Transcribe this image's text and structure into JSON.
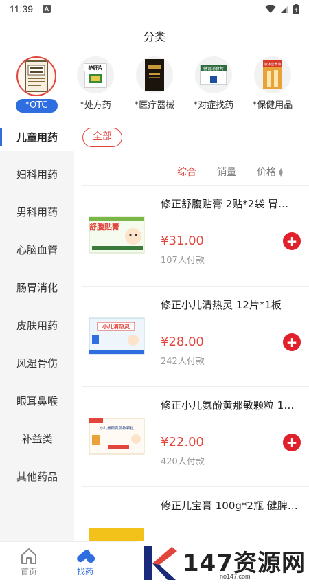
{
  "status": {
    "time": "11:39",
    "a_icon": "A"
  },
  "header": {
    "title": "分类"
  },
  "categories": [
    {
      "label": "*OTC",
      "active": true,
      "icon": "otc-book-icon"
    },
    {
      "label": "*处方药",
      "active": false,
      "icon": "prescription-box-icon",
      "box_text": "护肝片"
    },
    {
      "label": "*医疗器械",
      "active": false,
      "icon": "medical-device-box-icon"
    },
    {
      "label": "*对症找药",
      "active": false,
      "icon": "symptom-medicine-box-icon",
      "box_text": "健胃消食片"
    },
    {
      "label": "*保健用品",
      "active": false,
      "icon": "health-product-box-icon",
      "box_text": "液体营养液"
    }
  ],
  "sidebar": {
    "items": [
      {
        "label": "儿童用药",
        "active": true
      },
      {
        "label": "妇科用药"
      },
      {
        "label": "男科用药"
      },
      {
        "label": "心脑血管"
      },
      {
        "label": "肠胃消化"
      },
      {
        "label": "皮肤用药"
      },
      {
        "label": "风湿骨伤"
      },
      {
        "label": "眼耳鼻喉"
      },
      {
        "label": "补益类"
      },
      {
        "label": "其他药品"
      }
    ]
  },
  "filter": {
    "all_label": "全部"
  },
  "sort": {
    "comprehensive": "综合",
    "sales": "销量",
    "price": "价格"
  },
  "products": [
    {
      "title": "修正舒腹贴膏 2贴*2袋 胃…",
      "price": "¥31.00",
      "paid": "107人付款",
      "box_text": "舒腹贴膏"
    },
    {
      "title": "修正小儿清热灵 12片*1板",
      "price": "¥28.00",
      "paid": "242人付款",
      "box_text": "小儿清热灵"
    },
    {
      "title": "修正小儿氨酚黄那敏颗粒 1…",
      "price": "¥22.00",
      "paid": "420人付款",
      "box_text": "小儿氨酚黄那敏颗粒"
    },
    {
      "title": "修正儿宝膏 100g*2瓶 健脾…",
      "price": "",
      "paid": "",
      "box_text": ""
    }
  ],
  "bottom_nav": [
    {
      "label": "首页",
      "icon": "home-icon",
      "active": false
    },
    {
      "label": "找药",
      "icon": "pills-icon",
      "active": true
    }
  ],
  "watermark": {
    "text": "147资源网",
    "url": "no147.com"
  },
  "colors": {
    "accent_red": "#e2453c",
    "accent_blue": "#2f6ee0",
    "add_red": "#e0202b"
  }
}
